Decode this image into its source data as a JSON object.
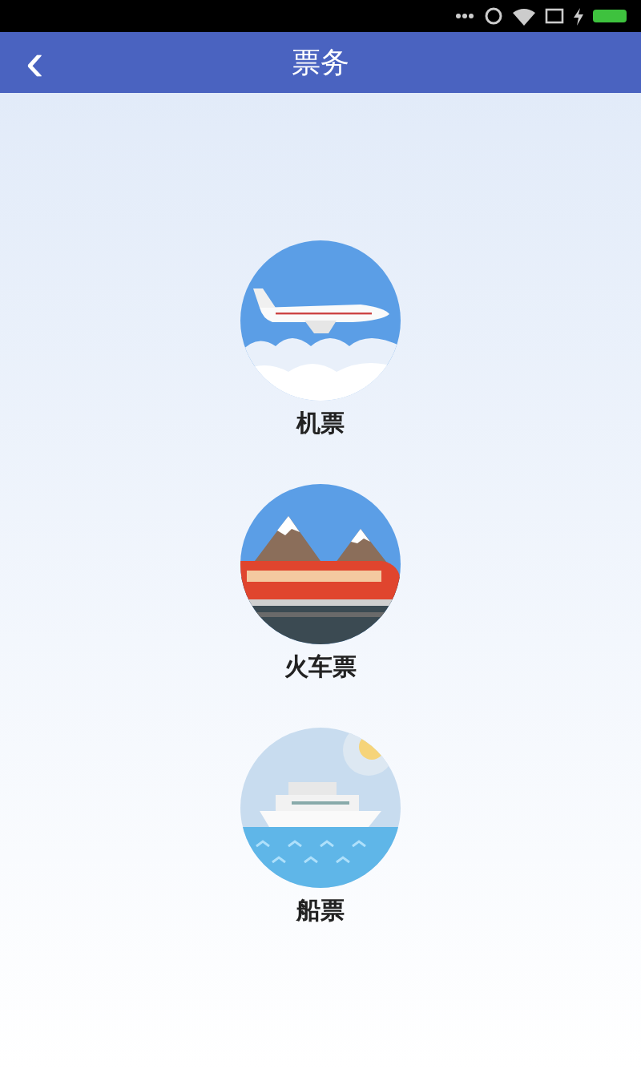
{
  "header": {
    "back": "‹",
    "title": "票务"
  },
  "items": [
    {
      "kind": "plane",
      "label": "机票"
    },
    {
      "kind": "train",
      "label": "火车票"
    },
    {
      "kind": "ship",
      "label": "船票"
    }
  ]
}
